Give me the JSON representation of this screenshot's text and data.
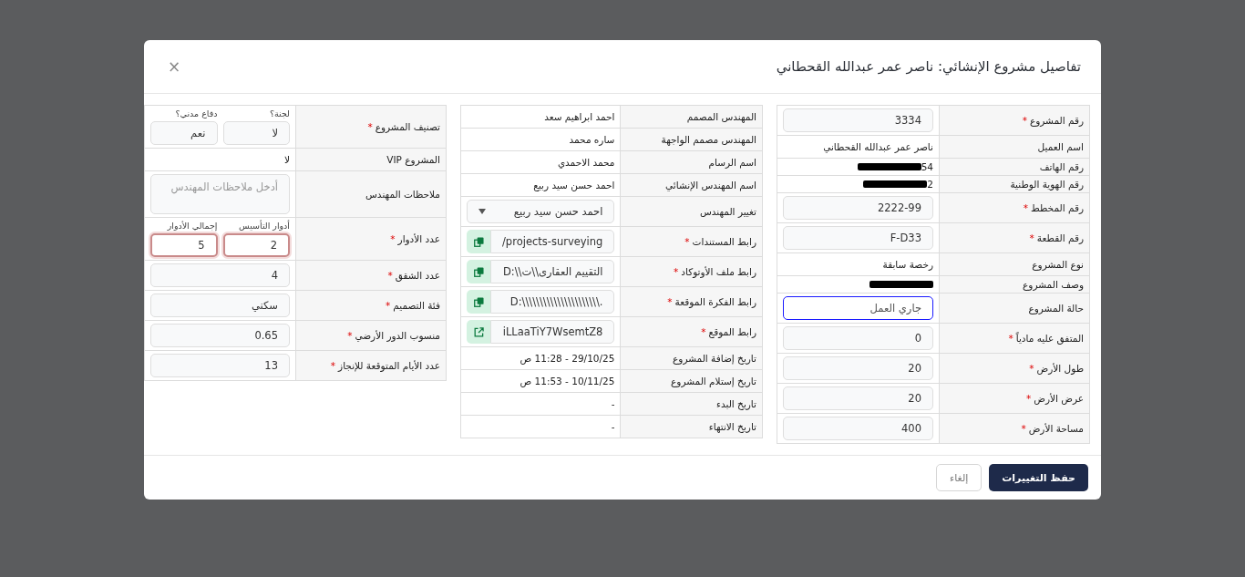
{
  "modal": {
    "title": "تفاصيل مشروع الإنشائي: ناصر عمر عبدالله القحطاني",
    "close": "×"
  },
  "columns": [
    {
      "rows": [
        {
          "kind": "input",
          "label": "رقم المشروع",
          "required_mark": "*",
          "value": "3334",
          "focused": false
        },
        {
          "kind": "text",
          "label": "اسم العميل",
          "value": "ناصر عمر عبدالله القحطاني"
        },
        {
          "kind": "redacted",
          "label": "رقم الهاتف",
          "value": "54"
        },
        {
          "kind": "redacted",
          "label": "رقم الهوية الوطنية",
          "value": "2"
        },
        {
          "kind": "input",
          "label": "رقم المخطط",
          "required_mark": "*",
          "value": "2222-99",
          "focused": false
        },
        {
          "kind": "input",
          "label": "رقم القطعة",
          "required_mark": "*",
          "value": "F-D33",
          "focused": false
        },
        {
          "kind": "text",
          "label": "نوع المشروع",
          "value": "رخصة سابقة"
        },
        {
          "kind": "redacted",
          "label": "وصف المشروع"
        },
        {
          "kind": "input",
          "label": "حالة المشروع",
          "value": "جاري العمل",
          "focused": true
        },
        {
          "kind": "input",
          "label": "المتفق عليه مادياً",
          "required_mark": "*",
          "value": "0",
          "focused": false
        },
        {
          "kind": "input",
          "label": "طول الأرض",
          "required_mark": "*",
          "value": "20",
          "focused": false
        },
        {
          "kind": "input",
          "label": "عرض الأرض",
          "required_mark": "*",
          "value": "20",
          "focused": false
        },
        {
          "kind": "input",
          "label": "مساحة الأرض",
          "required_mark": "*",
          "value": "400",
          "focused": false
        }
      ]
    },
    {
      "rows": [
        {
          "kind": "text",
          "label": "المهندس المصمم",
          "value": "احمد ابراهيم سعد"
        },
        {
          "kind": "text",
          "label": "المهندس مصمم الواجهة",
          "value": "ساره محمد"
        },
        {
          "kind": "text",
          "label": "اسم الرسام",
          "value": "محمد الاحمدي"
        },
        {
          "kind": "text",
          "label": "اسم المهندس الإنشائي",
          "value": "احمد حسن سيد ربيع"
        },
        {
          "kind": "select",
          "label": "تغيير المهندس",
          "value": "احمد حسن سيد ربيع"
        },
        {
          "kind": "link",
          "label": "رابط المستندات",
          "required_mark": "*",
          "value": "/projects-surveying",
          "action": {
            "kind": "copy"
          }
        },
        {
          "kind": "link",
          "label": "رابط ملف الأوتوكاد",
          "required_mark": "*",
          "value": "D:\\\\التقييم العقارى\\\\ت",
          "action": {
            "kind": "copy"
          }
        },
        {
          "kind": "link",
          "label": "رابط الفكرة الموقعة",
          "required_mark": "*",
          "value": "D:\\\\\\\\\\\\\\\\\\\\\\\\\\\\\\\\\\\\\\\\\\\\.",
          "action": {
            "kind": "copy"
          }
        },
        {
          "kind": "link",
          "label": "رابط الموقع",
          "required_mark": "*",
          "value": "iLLaaTiY7WsemtZ8",
          "action": {
            "kind": "open"
          }
        },
        {
          "kind": "text",
          "label": "تاريخ إضافة المشروع",
          "value": "29/10/25 - 11:28 ص"
        },
        {
          "kind": "text",
          "label": "تاريخ إستلام المشروع",
          "value": "10/11/25 - 11:53 ص"
        },
        {
          "kind": "text",
          "label": "تاريخ البدء",
          "value": "-"
        },
        {
          "kind": "text",
          "label": "تاريخ الانتهاء",
          "value": "-"
        }
      ]
    },
    {
      "rows": [
        {
          "kind": "pair",
          "label": "تصنيف المشروع",
          "required_mark": "*",
          "fields": [
            {
              "caption": "لجنة؟",
              "value": "لا",
              "invalid": false
            },
            {
              "caption": "دفاع مدني؟",
              "value": "نعم",
              "invalid": false
            }
          ]
        },
        {
          "kind": "text",
          "label": "المشروع VIP",
          "value": "لا"
        },
        {
          "kind": "textarea",
          "label": "ملاحظات المهندس",
          "placeholder": "أدخل ملاحظات المهندس"
        },
        {
          "kind": "pair",
          "label": "عدد الأدوار",
          "required_mark": "*",
          "fields": [
            {
              "caption": "أدوار التأسيس",
              "value": "2",
              "invalid": true
            },
            {
              "caption": "إجمالي الأدوار",
              "value": "5",
              "invalid": true
            }
          ]
        },
        {
          "kind": "input",
          "label": "عدد الشقق",
          "required_mark": "*",
          "value": "4",
          "focused": false
        },
        {
          "kind": "input",
          "label": "فئة التصميم",
          "required_mark": "*",
          "value": "سكني",
          "focused": false
        },
        {
          "kind": "input",
          "label": "منسوب الدور الأرضي",
          "required_mark": "*",
          "value": "0.65",
          "focused": false
        },
        {
          "kind": "input",
          "label": "عدد الأيام المتوقعة للإنجاز",
          "required_mark": "*",
          "value": "13",
          "focused": false
        }
      ]
    }
  ],
  "footer": {
    "buttons": [
      {
        "label": "حفظ التغييرات",
        "kind": "primary"
      },
      {
        "label": "إلغاء",
        "kind": "secondary"
      }
    ]
  }
}
